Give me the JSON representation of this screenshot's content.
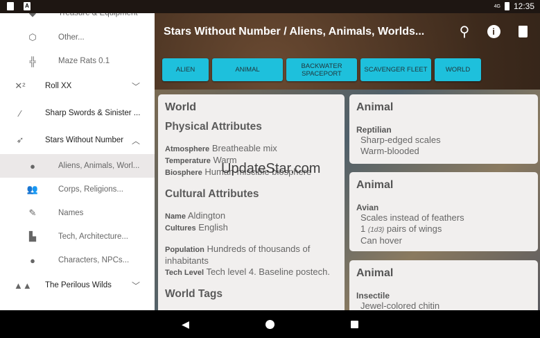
{
  "status_bar": {
    "time": "12:35",
    "network": "4G"
  },
  "toolbar": {
    "title": "Stars Without Number / Aliens, Animals, Worlds..."
  },
  "chips": [
    "ALIEN",
    "ANIMAL",
    "BACKWATER SPACEPORT",
    "SCAVENGER FLEET",
    "WORLD"
  ],
  "drawer": {
    "items": [
      {
        "label": "Treasure & Equipment",
        "level": "sub",
        "icon": "gem-icon"
      },
      {
        "label": "Other...",
        "level": "sub",
        "icon": "d20-icon"
      },
      {
        "label": "Maze Rats 0.1",
        "level": "sub",
        "icon": "maze-icon"
      },
      {
        "label": "Roll XX",
        "level": "top",
        "icon": "x-squared-icon",
        "chevron": "down"
      },
      {
        "label": "Sharp Swords & Sinister ...",
        "level": "top",
        "icon": "magic-wand-icon"
      },
      {
        "label": "Stars Without Number",
        "level": "top",
        "icon": "rocket-icon",
        "chevron": "up"
      },
      {
        "label": "Aliens, Animals, Worl...",
        "level": "sub",
        "icon": "planet-icon",
        "selected": true
      },
      {
        "label": "Corps, Religions...",
        "level": "sub",
        "icon": "people-icon"
      },
      {
        "label": "Names",
        "level": "sub",
        "icon": "pencil-icon"
      },
      {
        "label": "Tech, Architecture...",
        "level": "sub",
        "icon": "factory-icon"
      },
      {
        "label": "Characters, NPCs...",
        "level": "sub",
        "icon": "person-icon"
      },
      {
        "label": "The Perilous Wilds",
        "level": "top",
        "icon": "mountains-icon",
        "chevron": "down"
      }
    ]
  },
  "world_card": {
    "title": "World",
    "physical_heading": "Physical Attributes",
    "atmosphere_label": "Atmosphere",
    "atmosphere": "Breatheable mix",
    "temperature_label": "Temperature",
    "temperature": "Warm",
    "biosphere_label": "Biosphere",
    "biosphere": "Human-miscible biosphere",
    "cultural_heading": "Cultural Attributes",
    "name_label": "Name",
    "name": "Aldington",
    "cultures_label": "Cultures",
    "cultures": "English",
    "population_label": "Population",
    "population": "Hundreds of thousands of inhabitants",
    "tech_label": "Tech Level",
    "tech": "Tech level 4. Baseline postech.",
    "tags_heading": "World Tags"
  },
  "animal_cards": [
    {
      "title": "Animal",
      "type": "Reptilian",
      "traits": [
        "Sharp-edged scales",
        "Warm-blooded"
      ]
    },
    {
      "title": "Animal",
      "type": "Avian",
      "traits": [
        "Scales instead of feathers",
        "pairs of wings",
        "Can hover"
      ],
      "wing_count": "1",
      "wing_roll": "(1d3)"
    },
    {
      "title": "Animal",
      "type": "Insectile",
      "traits": [
        "Jewel-colored chitin"
      ]
    }
  ],
  "watermark": "UpdateStar.com"
}
